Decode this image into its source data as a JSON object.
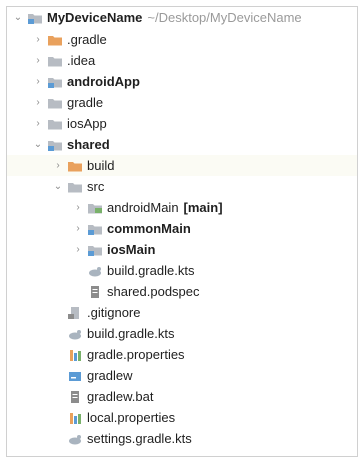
{
  "tree": {
    "root": {
      "label": "MyDeviceName",
      "path": "~/Desktop/MyDeviceName"
    },
    "items": [
      {
        "label": ".gradle"
      },
      {
        "label": ".idea"
      },
      {
        "label": "androidApp"
      },
      {
        "label": "gradle"
      },
      {
        "label": "iosApp"
      },
      {
        "label": "shared"
      },
      {
        "label": "build"
      },
      {
        "label": "src"
      },
      {
        "label": "androidMain",
        "tag": "[main]"
      },
      {
        "label": "commonMain"
      },
      {
        "label": "iosMain"
      },
      {
        "label": "build.gradle.kts"
      },
      {
        "label": "shared.podspec"
      },
      {
        "label": ".gitignore"
      },
      {
        "label": "build.gradle.kts"
      },
      {
        "label": "gradle.properties"
      },
      {
        "label": "gradlew"
      },
      {
        "label": "gradlew.bat"
      },
      {
        "label": "local.properties"
      },
      {
        "label": "settings.gradle.kts"
      }
    ]
  },
  "colors": {
    "folder_gray": "#b7bcc3",
    "folder_orange": "#e9a15d",
    "module_blue": "#5b9bd5",
    "source_green": "#79b16a"
  }
}
